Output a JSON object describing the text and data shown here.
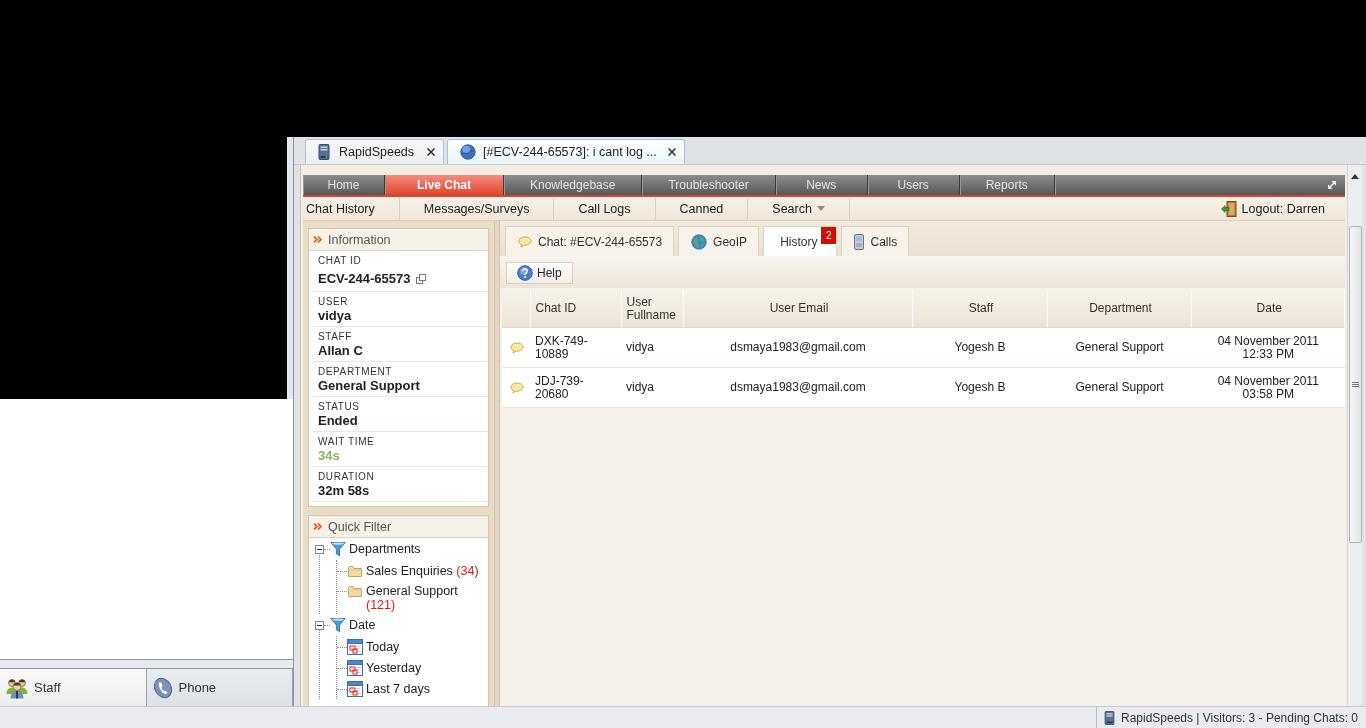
{
  "browser_tabs": [
    {
      "label": "RapidSpeeds",
      "kind": "app",
      "selected": false
    },
    {
      "label": "[#ECV-244-65573]: i cant log ...",
      "kind": "page",
      "selected": true
    }
  ],
  "nav": [
    {
      "label": "Home",
      "selected": false
    },
    {
      "label": "Live Chat",
      "selected": true
    },
    {
      "label": "Knowledgebase",
      "selected": false
    },
    {
      "label": "Troubleshooter",
      "selected": false
    },
    {
      "label": "News",
      "selected": false
    },
    {
      "label": "Users",
      "selected": false
    },
    {
      "label": "Reports",
      "selected": false
    }
  ],
  "subnav": [
    {
      "label": "Chat History",
      "dropdown": false
    },
    {
      "label": "Messages/Surveys",
      "dropdown": false
    },
    {
      "label": "Call Logs",
      "dropdown": false
    },
    {
      "label": "Canned",
      "dropdown": false
    },
    {
      "label": "Search",
      "dropdown": true
    }
  ],
  "logout": "Logout: Darren",
  "information": {
    "title": "Information",
    "fields": [
      {
        "label": "CHAT ID",
        "value": "ECV-244-65573",
        "kind": "id"
      },
      {
        "label": "USER",
        "value": "vidya",
        "kind": "text"
      },
      {
        "label": "STAFF",
        "value": "Allan C",
        "kind": "text"
      },
      {
        "label": "DEPARTMENT",
        "value": "General Support",
        "kind": "text"
      },
      {
        "label": "STATUS",
        "value": "Ended",
        "kind": "text"
      },
      {
        "label": "WAIT TIME",
        "value": "34s",
        "kind": "highlight"
      },
      {
        "label": "DURATION",
        "value": "32m 58s",
        "kind": "text"
      }
    ]
  },
  "quick_filter": {
    "title": "Quick Filter",
    "tree": [
      {
        "label": "Departments",
        "expanded": true,
        "children": [
          {
            "label": "Sales Enquiries",
            "count": "(34)",
            "kind": "folder"
          },
          {
            "label": "General Support",
            "count": "(121)",
            "kind": "folder"
          }
        ]
      },
      {
        "label": "Date",
        "expanded": true,
        "children": [
          {
            "label": "Today",
            "kind": "calendar"
          },
          {
            "label": "Yesterday",
            "kind": "calendar"
          },
          {
            "label": "Last 7 days",
            "kind": "calendar"
          }
        ]
      }
    ]
  },
  "content_tabs": [
    {
      "label": "Chat: #ECV-244-65573",
      "kind": "chat",
      "selected": false
    },
    {
      "label": "GeoIP",
      "kind": "geo",
      "selected": false
    },
    {
      "label": "History",
      "kind": "plain",
      "selected": true,
      "badge": "2"
    },
    {
      "label": "Calls",
      "kind": "calls",
      "selected": false
    }
  ],
  "toolbar": {
    "help_button": "Help"
  },
  "history_table": {
    "columns": [
      "Chat ID",
      "User Fullname",
      "User Email",
      "Staff",
      "Department",
      "Date"
    ],
    "rows": [
      {
        "cells": [
          "DXK-749-10889",
          "vidya",
          "dsmaya1983@gmail.com",
          "Yogesh B",
          "General Support",
          "04 November 2011 12:33 PM"
        ]
      },
      {
        "cells": [
          "JDJ-739-20680",
          "vidya",
          "dsmaya1983@gmail.com",
          "Yogesh B",
          "General Support",
          "04 November 2011 03:58 PM"
        ]
      }
    ]
  },
  "side_buttons": [
    {
      "label": "Staff",
      "kind": "staff",
      "selected": true
    },
    {
      "label": "Phone",
      "kind": "phone",
      "selected": false
    }
  ],
  "status_bar": "RapidSpeeds | Visitors: 3 - Pending Chats: 0"
}
